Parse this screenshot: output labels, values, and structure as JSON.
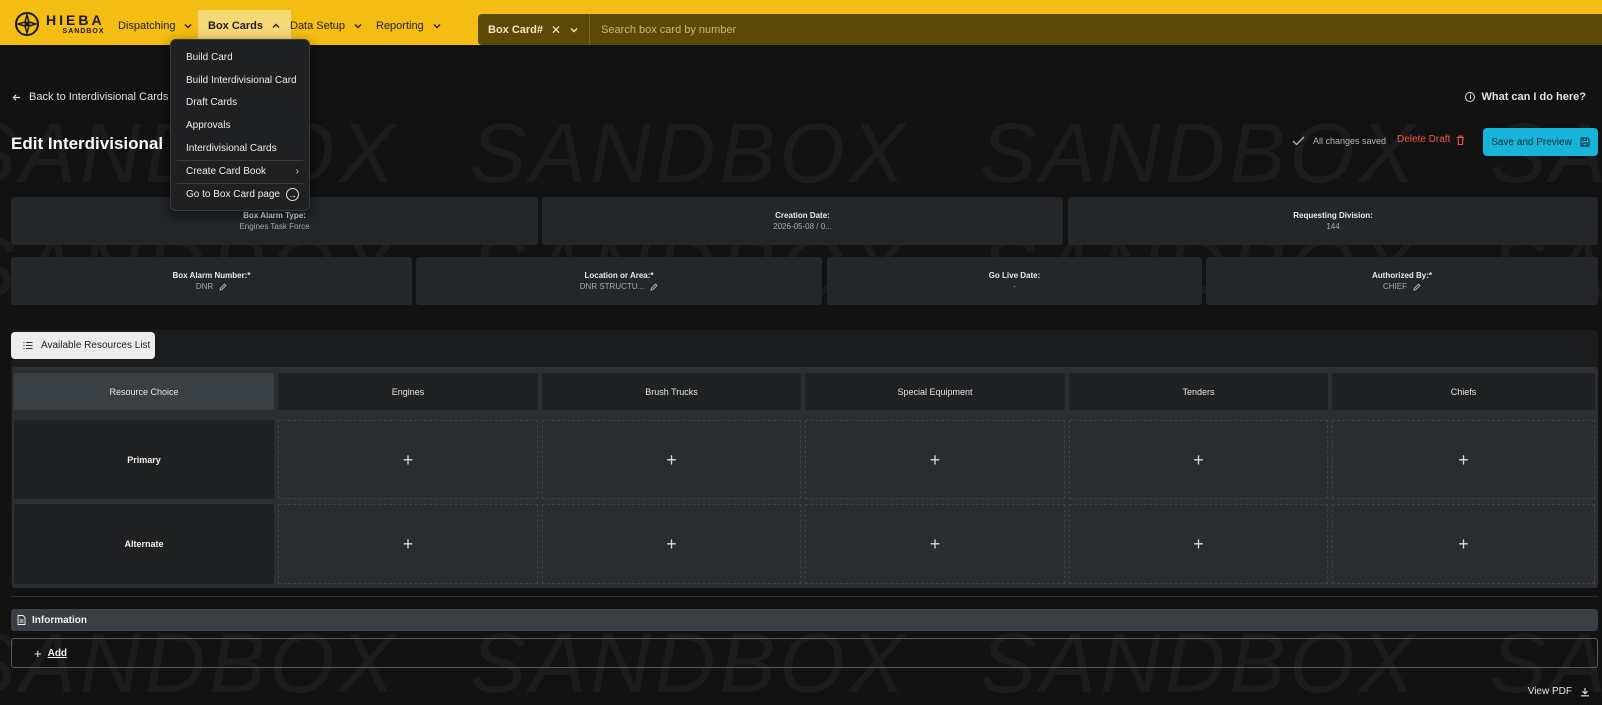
{
  "brand": {
    "name": "HIEBA",
    "env": "SANDBOX"
  },
  "nav": {
    "dispatching": "Dispatching",
    "box_cards": "Box Cards",
    "data_setup": "Data Setup",
    "reporting": "Reporting"
  },
  "search": {
    "type_label": "Box Card#",
    "placeholder": "Search box card by number"
  },
  "dropdown": {
    "items": [
      "Build Card",
      "Build Interdivisional Card",
      "Draft Cards",
      "Approvals",
      "Interdivisional Cards",
      "Create Card Book",
      "Go to Box Card page"
    ]
  },
  "page": {
    "back_label": "Back to Interdivisional Cards",
    "help_label": "What can I do here?",
    "title": "Edit Interdivisional Draft",
    "saved_status": "All changes saved",
    "delete_label": "Delete Draft",
    "save_label": "Save and Preview",
    "watermark": "SANDBOX"
  },
  "fields": {
    "box_alarm_type": {
      "label": "Box Alarm Type:",
      "value": "Engines Task Force"
    },
    "creation_date": {
      "label": "Creation Date:",
      "value": "2026-05-08 / 0..."
    },
    "requesting_division": {
      "label": "Requesting Division:",
      "value": "144"
    },
    "box_alarm_number": {
      "label": "Box Alarm Number:*",
      "value": "DNR"
    },
    "location": {
      "label": "Location or Area:*",
      "value": "DNR STRUCTU..."
    },
    "go_live": {
      "label": "Go Live Date:",
      "value": "-"
    },
    "authorized_by": {
      "label": "Authorized By:*",
      "value": "CHIEF"
    }
  },
  "resources": {
    "button_label": "Available Resources List",
    "columns": [
      "Resource Choice",
      "Engines",
      "Brush Trucks",
      "Special Equipment",
      "Tenders",
      "Chiefs"
    ],
    "rows": [
      "Primary",
      "Alternate"
    ],
    "add_symbol": "+"
  },
  "information": {
    "label": "Information",
    "add_label": "Add"
  },
  "footer": {
    "view_pdf": "View PDF"
  },
  "colors": {
    "nav_yellow": "#f3bd13",
    "accent_blue": "#17b3d8",
    "danger": "#f15a4a",
    "bg": "#121212"
  }
}
